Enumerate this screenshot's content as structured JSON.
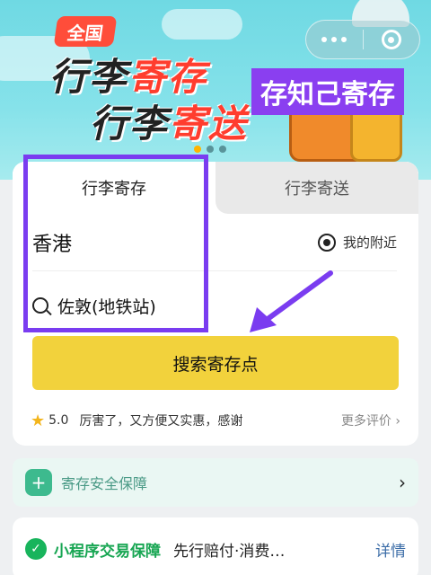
{
  "banner": {
    "badge": "全国",
    "slogan_line1_a": "行李",
    "slogan_line1_b": "寄存",
    "slogan_line2_a": "行李",
    "slogan_line2_b": "寄送",
    "watermark": "存知己寄存"
  },
  "tabs": {
    "storage": "行李寄存",
    "delivery": "行李寄送"
  },
  "search": {
    "city": "香港",
    "nearby": "我的附近",
    "station": "佐敦(地铁站)",
    "button": "搜索寄存点"
  },
  "review": {
    "rating": "5.0",
    "text": "厉害了，又方便又实惠，感谢",
    "more": "更多评价"
  },
  "safety": {
    "label": "寄存安全保障"
  },
  "guarantee": {
    "title": "小程序交易保障",
    "desc": "先行赔付·消费…",
    "detail": "详情"
  },
  "colors": {
    "accent_yellow": "#f2d23c",
    "highlight_purple": "#7a3cf0",
    "safety_green": "#3dba8e"
  }
}
